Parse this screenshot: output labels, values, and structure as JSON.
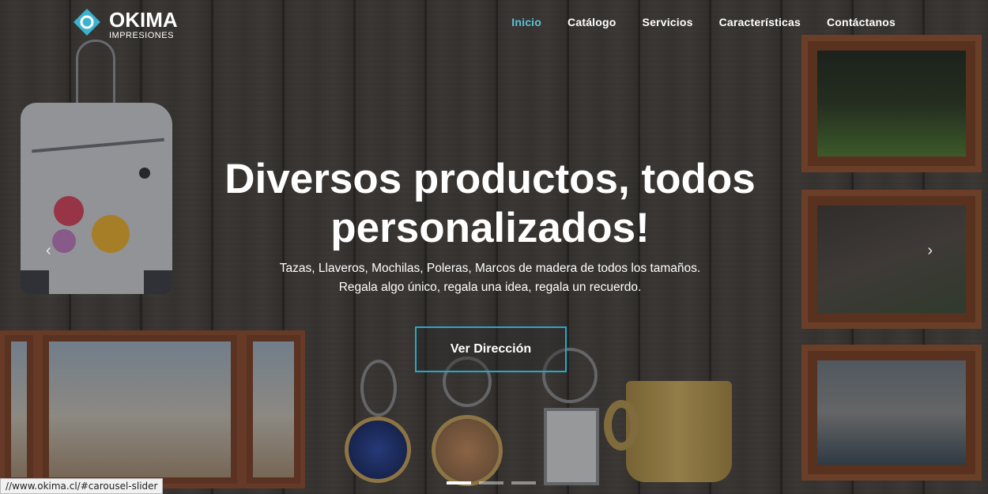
{
  "brand": {
    "name": "OKIMA",
    "sub": "IMPRESIONES"
  },
  "nav": [
    {
      "label": "Inicio",
      "active": true
    },
    {
      "label": "Catálogo"
    },
    {
      "label": "Servicios"
    },
    {
      "label": "Características"
    },
    {
      "label": "Contáctanos"
    }
  ],
  "hero": {
    "title_line1": "Diversos productos, todos",
    "title_line2": "personalizados!",
    "subtitle_line1": "Tazas, Llaveros, Mochilas, Poleras, Marcos de madera de todos los tamaños.",
    "subtitle_line2": "Regala algo único, regala una idea, regala un recuerdo.",
    "cta_label": "Ver Dirección"
  },
  "carousel": {
    "prev_icon": "chevron-left-icon",
    "next_icon": "chevron-right-icon",
    "slides": 3,
    "active_slide": 1
  },
  "status_url": "//www.okima.cl/#carousel-slider",
  "colors": {
    "accent": "#5bc4d8",
    "cta_border": "#2aa7c6"
  }
}
